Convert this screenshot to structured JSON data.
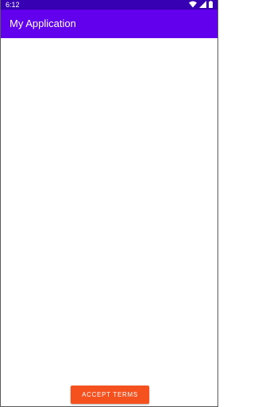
{
  "status_bar": {
    "time": "6:12",
    "icons": [
      "wifi-icon",
      "signal-icon",
      "battery-icon"
    ]
  },
  "app_bar": {
    "title": "My Application"
  },
  "actions": {
    "accept_label": "ACCEPT TERMS"
  },
  "colors": {
    "status_bar": "#3700b3",
    "app_bar": "#6200ee",
    "accept_button": "#f4511e"
  }
}
